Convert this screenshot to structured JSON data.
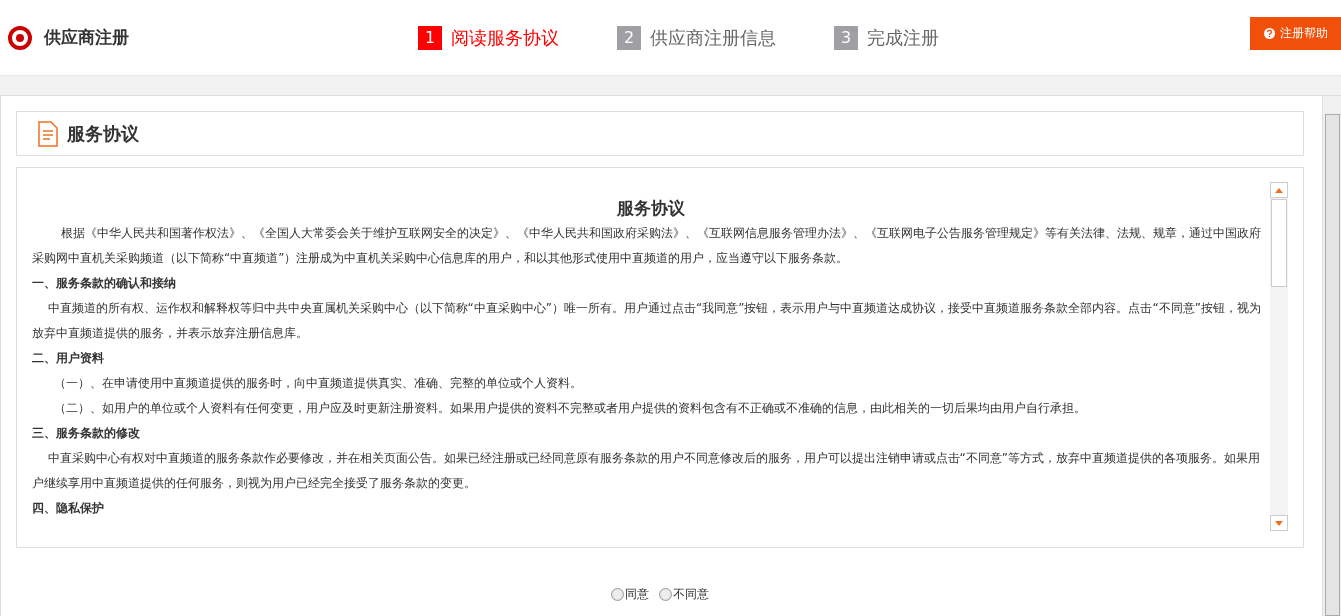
{
  "header": {
    "title": "供应商注册",
    "help_button": "注册帮助"
  },
  "steps": [
    {
      "number": "1",
      "label": "阅读服务协议",
      "selected": true
    },
    {
      "number": "2",
      "label": "供应商注册信息",
      "selected": false
    },
    {
      "number": "3",
      "label": "完成注册",
      "selected": false
    }
  ],
  "section_title": "服务协议",
  "agreement": {
    "title": "服务协议",
    "paragraphs": [
      {
        "kind": "lead",
        "text": "根据《中华人民共和国著作权法》、《全国人大常委会关于维护互联网安全的决定》、《中华人民共和国政府采购法》、《互联网信息服务管理办法》、《互联网电子公告服务管理规定》等有关法律、法规、规章，通过中国政府采购网中直机关采购频道（以下简称“中直频道”）注册成为中直机关采购中心信息库的用户，和以其他形式使用中直频道的用户，应当遵守以下服务条款。"
      },
      {
        "kind": "heading",
        "text": "一、服务条款的确认和接纳"
      },
      {
        "kind": "body",
        "text": "中直频道的所有权、运作权和解释权等归中共中央直属机关采购中心（以下简称“中直采购中心”）唯一所有。用户通过点击“我同意”按钮，表示用户与中直频道达成协议，接受中直频道服务条款全部内容。点击“不同意”按钮，视为放弃中直频道提供的服务，并表示放弃注册信息库。"
      },
      {
        "kind": "heading",
        "text": "二、用户资料"
      },
      {
        "kind": "item",
        "text": "（一）、在申请使用中直频道提供的服务时，向中直频道提供真实、准确、完整的单位或个人资料。"
      },
      {
        "kind": "item",
        "text": "（二）、如用户的单位或个人资料有任何变更，用户应及时更新注册资料。如果用户提供的资料不完整或者用户提供的资料包含有不正确或不准确的信息，由此相关的一切后果均由用户自行承担。"
      },
      {
        "kind": "heading",
        "text": "三、服务条款的修改"
      },
      {
        "kind": "body",
        "text": "中直采购中心有权对中直频道的服务条款作必要修改，并在相关页面公告。如果已经注册或已经同意原有服务条款的用户不同意修改后的服务，用户可以提出注销申请或点击“不同意”等方式，放弃中直频道提供的各项服务。如果用户继续享用中直频道提供的任何服务，则视为用户已经完全接受了服务条款的变更。"
      },
      {
        "kind": "heading",
        "text": "四、隐私保护"
      }
    ]
  },
  "choices": [
    {
      "label": "同意",
      "selected": false
    },
    {
      "label": "不同意",
      "selected": false
    }
  ]
}
